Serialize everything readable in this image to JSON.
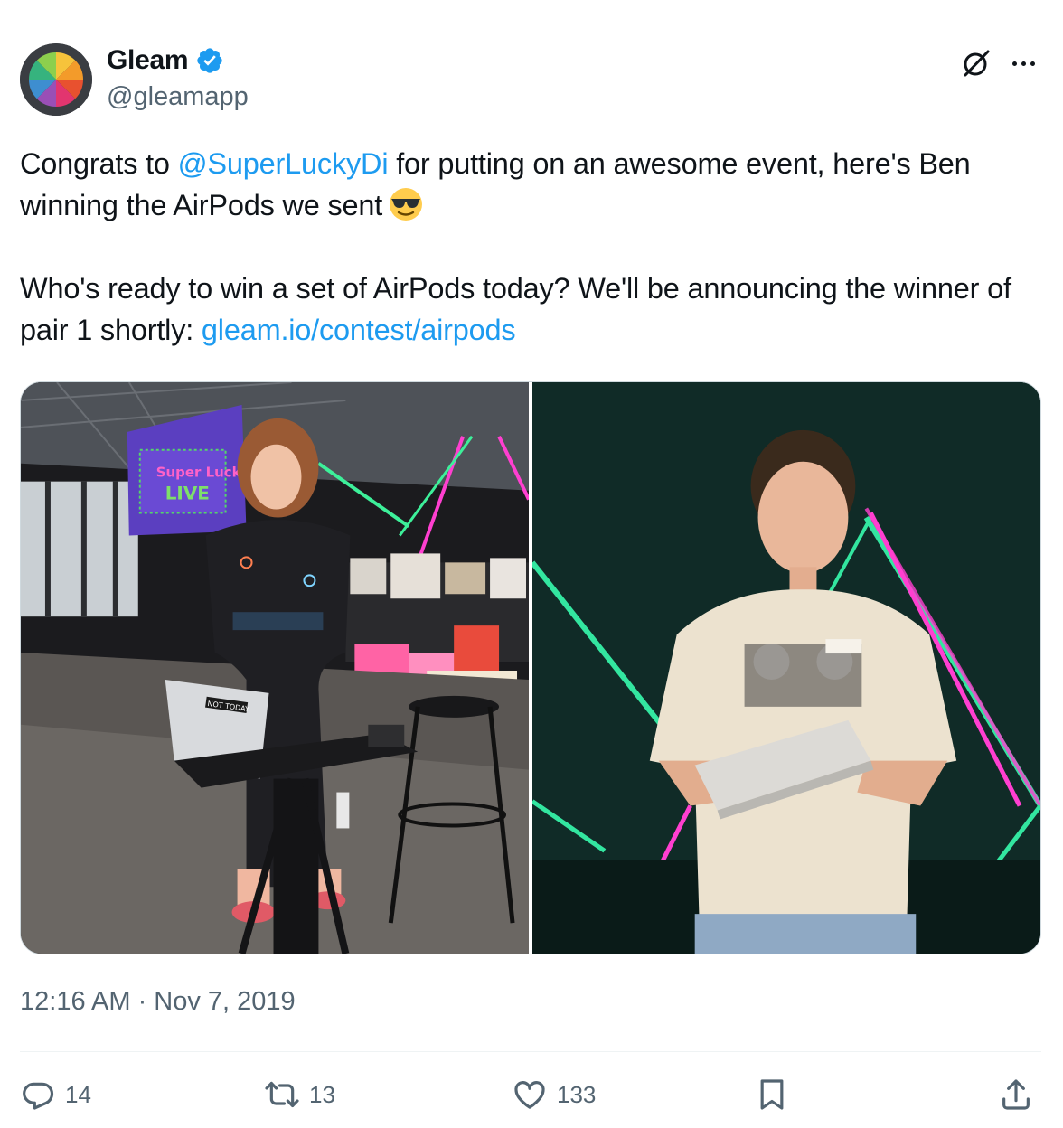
{
  "author": {
    "name": "Gleam",
    "handle": "@gleamapp",
    "verified": true,
    "avatar_icon": "gleam-logo-icon"
  },
  "header_icons": {
    "grok": "grok-icon",
    "more": "more-options-icon"
  },
  "tweet": {
    "line1_before": "Congrats to ",
    "mention": "@SuperLuckyDi",
    "line1_after": " for putting on an awesome event, here's Ben winning the AirPods we sent",
    "emoji": "smiling-face-with-sunglasses",
    "para2_before": "Who's ready to win a set of AirPods today? We'll be announcing the winner of pair 1 shortly: ",
    "link": "gleam.io/contest/airpods"
  },
  "media": {
    "left_photo_icon": "event-host-photo",
    "left_screen_text": "Super Lucky LIVE",
    "left_laptop_sticker": "NOT TODAY",
    "right_photo_icon": "winner-with-airpods-box-photo"
  },
  "timestamp": "12:16 AM · Nov 7, 2019",
  "actions": {
    "replies": "14",
    "reposts": "13",
    "likes": "133"
  },
  "colors": {
    "link": "#1d9bf0",
    "secondary_text": "#536471",
    "text": "#0f1419",
    "divider": "#eff3f4"
  }
}
